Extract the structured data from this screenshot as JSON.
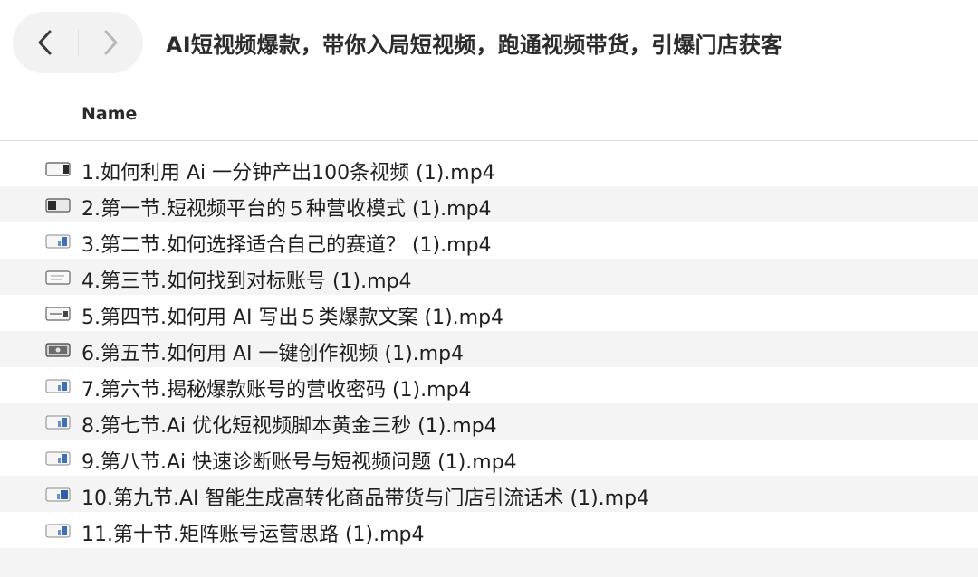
{
  "window": {
    "title": "AI短视频爆款，带你入局短视频，跑通视频带货，引爆门店获客"
  },
  "toolbar": {
    "back_icon": "chevron-left-icon",
    "forward_icon": "chevron-right-icon"
  },
  "list": {
    "column_name": "Name",
    "files": [
      {
        "name": "1.如何利用 Ai 一分钟产出100条视频 (1).mp4",
        "icon": "video-thumbnail-icon"
      },
      {
        "name": "2.第一节.短视频平台的５种营收模式 (1).mp4",
        "icon": "video-thumbnail-icon"
      },
      {
        "name": "3.第二节.如何选择适合自己的赛道？ (1).mp4",
        "icon": "video-thumbnail-icon"
      },
      {
        "name": "4.第三节.如何找到对标账号 (1).mp4",
        "icon": "video-thumbnail-icon"
      },
      {
        "name": "5.第四节.如何用 AI 写出５类爆款文案 (1).mp4",
        "icon": "video-thumbnail-icon"
      },
      {
        "name": "6.第五节.如何用 AI 一键创作视频 (1).mp4",
        "icon": "video-thumbnail-icon"
      },
      {
        "name": "7.第六节.揭秘爆款账号的营收密码 (1).mp4",
        "icon": "video-thumbnail-icon"
      },
      {
        "name": "8.第七节.Ai 优化短视频脚本黄金三秒 (1).mp4",
        "icon": "video-thumbnail-icon"
      },
      {
        "name": "9.第八节.Ai 快速诊断账号与短视频问题 (1).mp4",
        "icon": "video-thumbnail-icon"
      },
      {
        "name": "10.第九节.AI 智能生成高转化商品带货与门店引流话术 (1).mp4",
        "icon": "video-thumbnail-icon"
      },
      {
        "name": "11.第十节.矩阵账号运营思路 (1).mp4",
        "icon": "video-thumbnail-icon"
      }
    ]
  }
}
